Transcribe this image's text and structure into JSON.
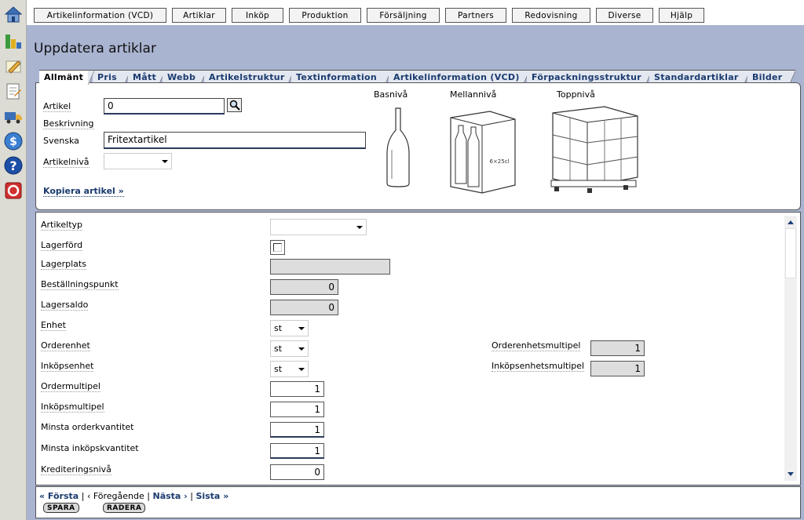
{
  "left_icons": [
    "home-icon",
    "chart-icon",
    "pencil-icon",
    "notepad-icon",
    "truck-icon",
    "dollar-icon",
    "help-icon",
    "exit-icon"
  ],
  "top_menu": [
    "Artikelinformation (VCD)",
    "Artiklar",
    "Inköp",
    "Produktion",
    "Försäljning",
    "Partners",
    "Redovisning",
    "Diverse",
    "Hjälp"
  ],
  "page_title": "Uppdatera artiklar",
  "tabs": [
    "Allmänt",
    "Pris",
    "Mått",
    "Webb",
    "Artikelstruktur",
    "Textinformation",
    "Artikelinformation (VCD)",
    "Förpackningsstruktur",
    "Standardartiklar",
    "Bilder"
  ],
  "general": {
    "artikel_label": "Artikel",
    "artikel_value": "0",
    "beskrivning_label": "Beskrivning",
    "svenska_label": "Svenska",
    "svenska_value": "Fritextartikel",
    "artikelniva_label": "Artikelnivå",
    "artikelniva_value": "",
    "copy_link": "Kopiera artikel »",
    "levels": [
      "Basnivå",
      "Mellannivå",
      "Toppnivå"
    ]
  },
  "detail": {
    "artikeltyp_label": "Artikeltyp",
    "artikeltyp_value": "",
    "lagerford_label": "Lagerförd",
    "lagerplats_label": "Lagerplats",
    "lagerplats_value": "",
    "bestpunkt_label": "Beställningspunkt",
    "bestpunkt_value": "0",
    "lagersaldo_label": "Lagersaldo",
    "lagersaldo_value": "0",
    "enhet_label": "Enhet",
    "enhet_value": "st",
    "orderenhet_label": "Orderenhet",
    "orderenhet_value": "st",
    "inkopsenhet_label": "Inköpsenhet",
    "inkopsenhet_value": "st",
    "ordermultipel_label": "Ordermultipel",
    "ordermultipel_value": "1",
    "inkopsmultipel_label": "Inköpsmultipel",
    "inkopsmultipel_value": "1",
    "minsta_order_label": "Minsta orderkvantitet",
    "minsta_order_value": "1",
    "minsta_inkop_label": "Minsta inköpskvantitet",
    "minsta_inkop_value": "1",
    "kreditering_label": "Krediteringsnivå",
    "kreditering_value": "0",
    "orderenhetsmultipel_label": "Orderenhetsmultipel",
    "orderenhetsmultipel_value": "1",
    "inkopsenhetsmultipel_label": "Inköpsenhetsmultipel",
    "inkopsenhetsmultipel_value": "1"
  },
  "pager": {
    "first": "« Första",
    "sep1": "|",
    "prev": "‹ Föregående",
    "sep2": "|",
    "next": "Nästa ›",
    "sep3": "|",
    "last": "Sista »",
    "save": "SPARA",
    "delete": "RADERA"
  }
}
